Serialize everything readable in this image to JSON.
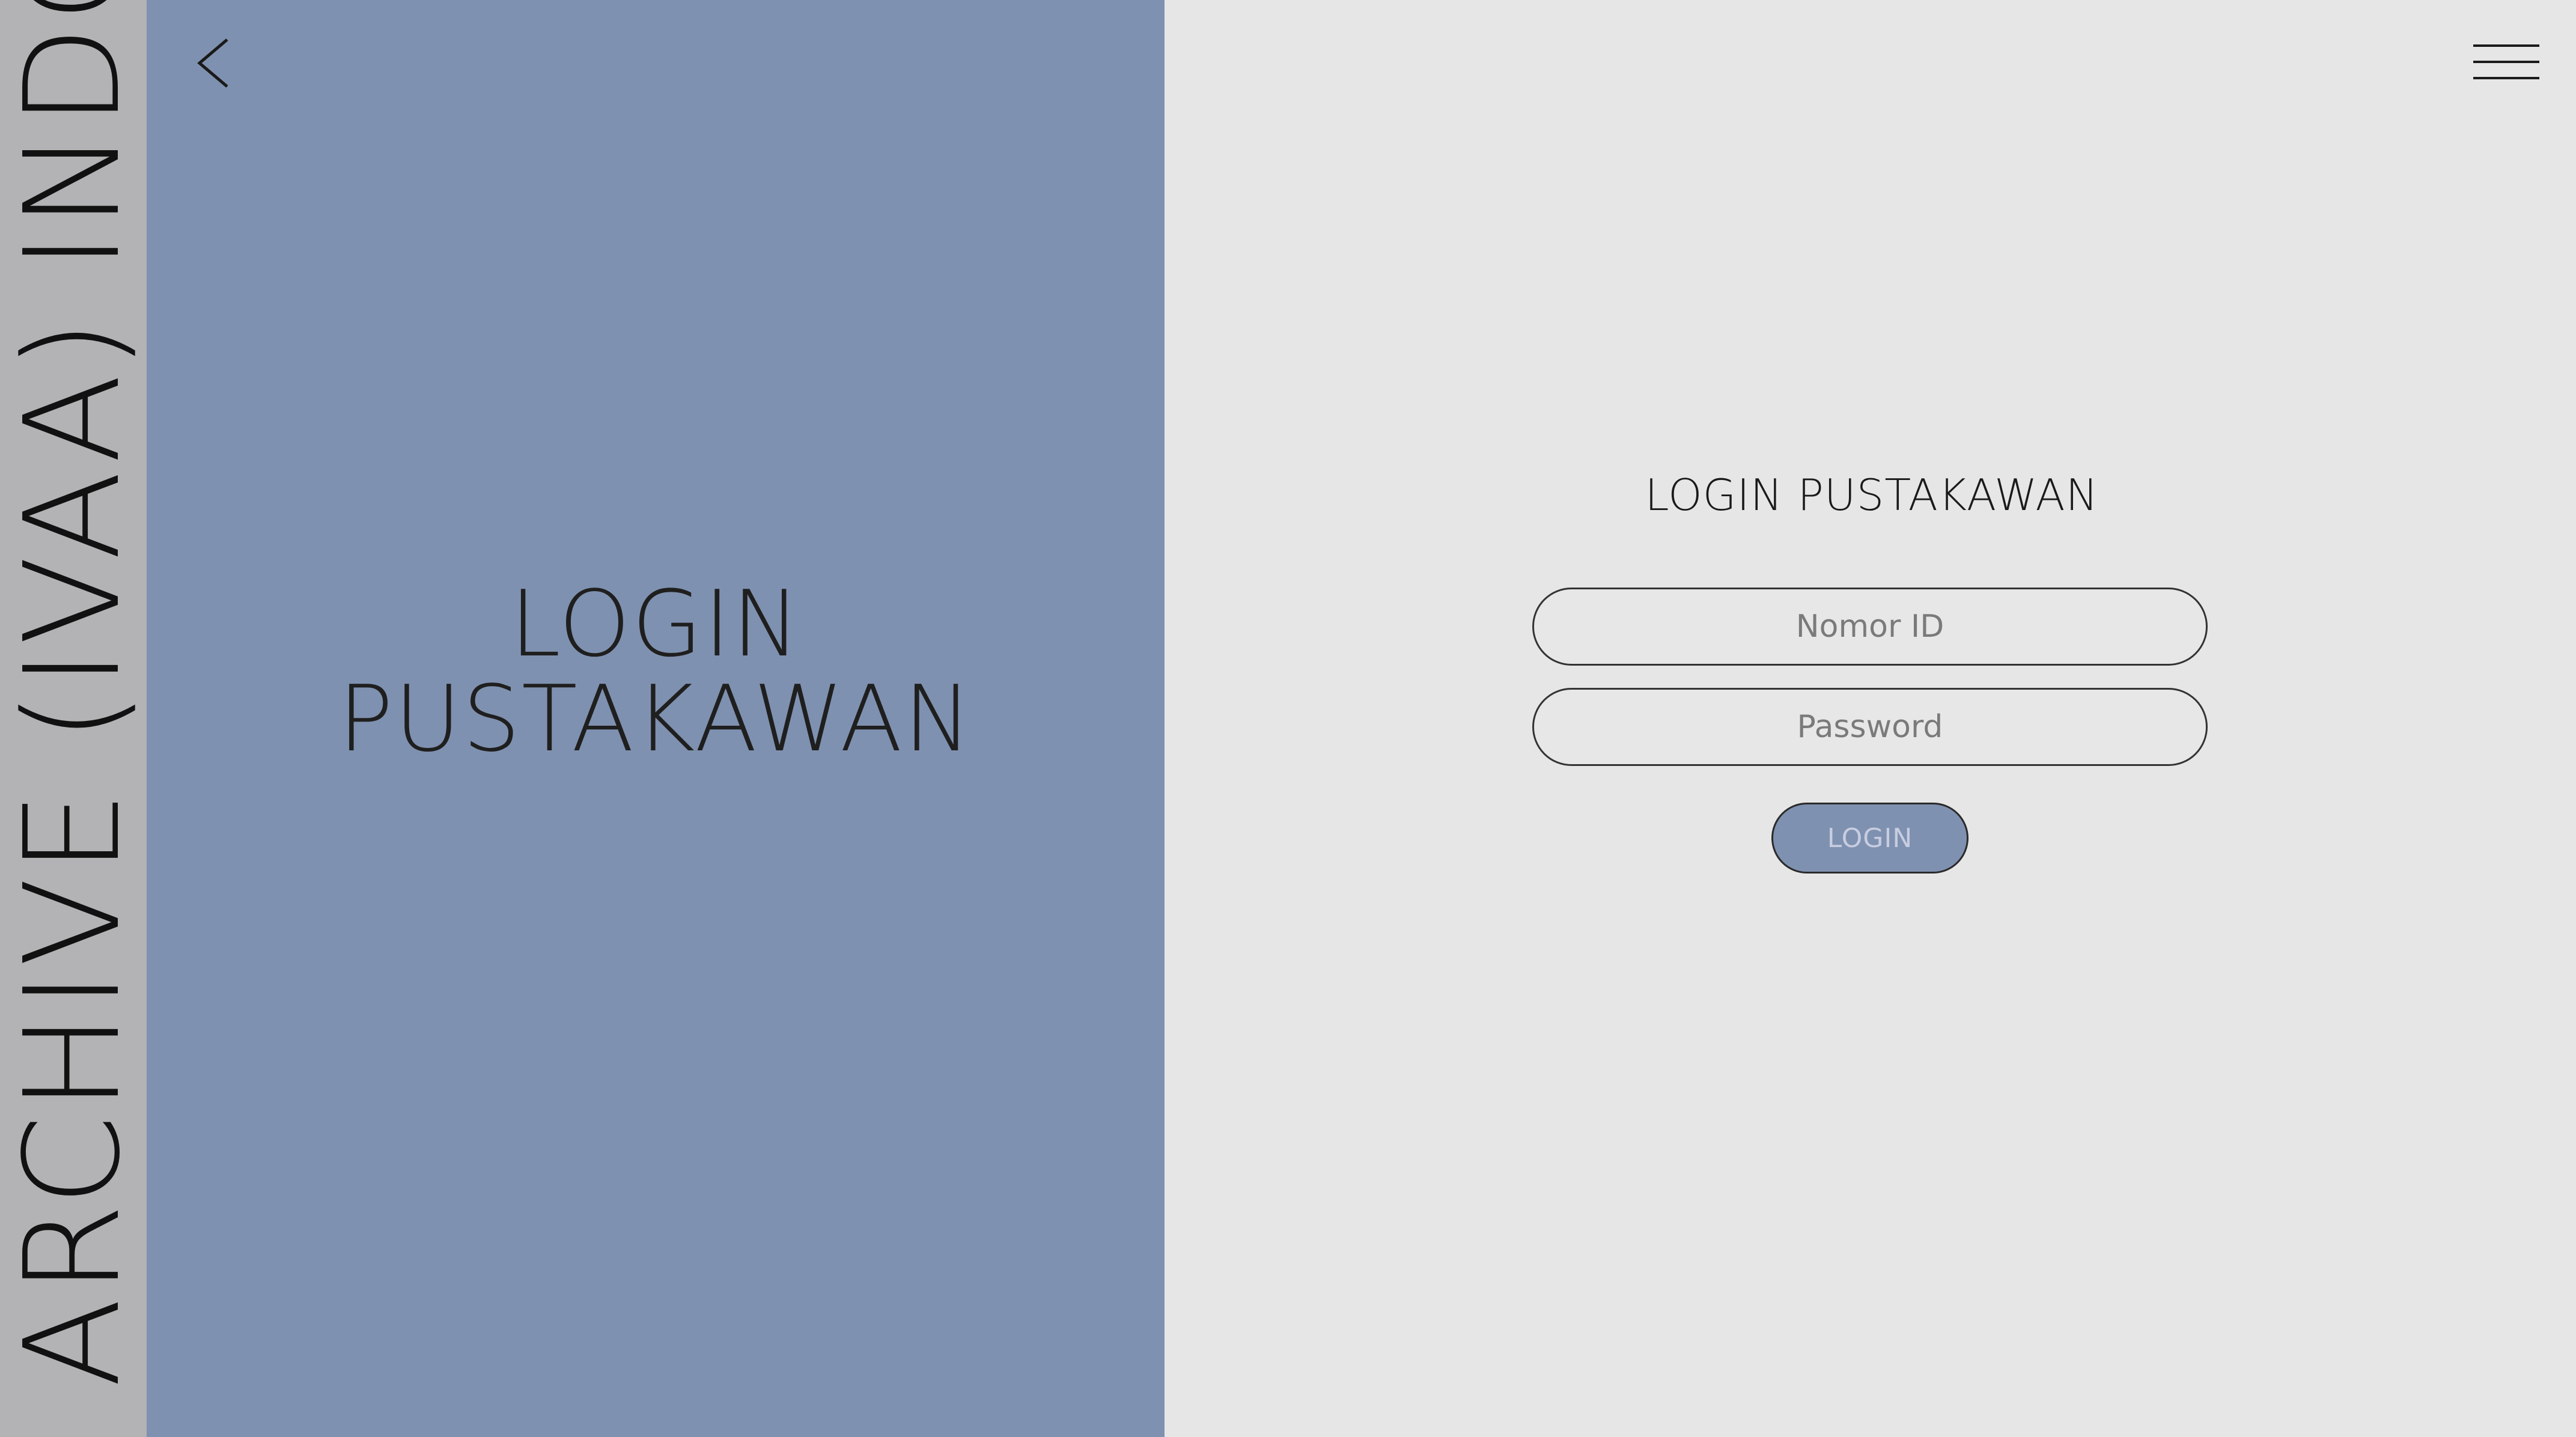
{
  "strip": {
    "text": "ARCHIVE (IVAA)   INDON"
  },
  "hero": {
    "line1": "LOGIN",
    "line2": "PUSTAKAWAN"
  },
  "form": {
    "title": "LOGIN PUSTAKAWAN",
    "id_placeholder": "Nomor ID",
    "id_value": "",
    "password_placeholder": "Password",
    "password_value": "",
    "submit_label": "LOGIN"
  },
  "icons": {
    "back": "chevron-left-icon",
    "menu": "hamburger-menu-icon"
  },
  "colors": {
    "panel_blue": "#7f91b0",
    "strip_gray": "#b3b2b4",
    "background": "#e7e6e7"
  }
}
